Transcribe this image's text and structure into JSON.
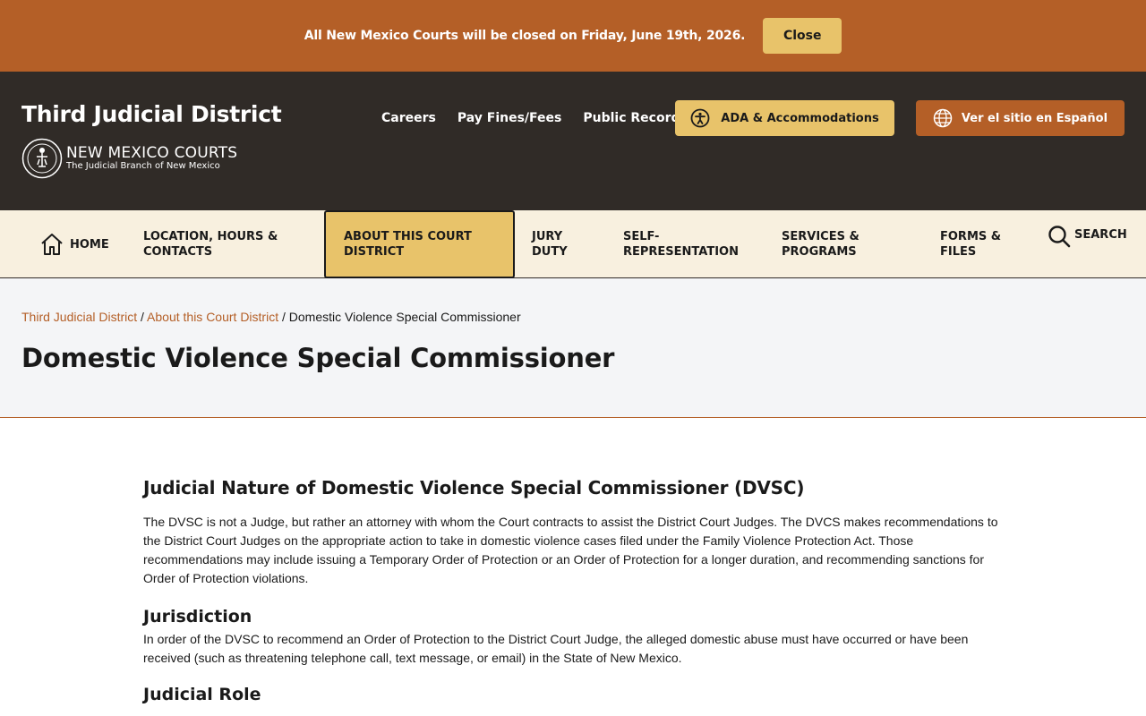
{
  "alert": {
    "text": "All New Mexico Courts will be closed on Friday, June 19th, 2026.",
    "close_label": "Close"
  },
  "header": {
    "site_title": "Third Judicial District",
    "logo_main": "NEW MEXICO COURTS",
    "logo_sub": "The Judicial Branch of New Mexico",
    "util_links": [
      "Careers",
      "Pay Fines/Fees",
      "Public Records"
    ],
    "ada_label": "ADA & Accommodations",
    "espanol_label": "Ver el sitio en Español"
  },
  "nav": {
    "home": "HOME",
    "location_line1": "LOCATION, HOURS &",
    "location_line2": "CONTACTS",
    "about_line1": "ABOUT THIS COURT",
    "about_line2": "DISTRICT",
    "jury_line1": "JURY",
    "jury_line2": "DUTY",
    "self_line1": "SELF-",
    "self_line2": "REPRESENTATION",
    "services_line1": "SERVICES &",
    "services_line2": "PROGRAMS",
    "forms_line1": "FORMS &",
    "forms_line2": "FILES",
    "search": "SEARCH"
  },
  "breadcrumb": {
    "crumb1": "Third Judicial District",
    "crumb2": "About this Court District",
    "current": "Domestic Violence Special Commissioner",
    "separator": "/"
  },
  "page": {
    "title": "Domestic Violence Special Commissioner"
  },
  "content": {
    "section1_heading": "Judicial Nature of Domestic Violence Special Commissioner (DVSC)",
    "section1_text": "The DVSC is not a Judge, but rather an attorney with whom the Court contracts to assist the District Court Judges. The DVCS makes recommendations to the District Court Judges on the appropriate action to take in domestic violence cases filed under the Family Violence Protection Act. Those recommendations may include issuing a Temporary Order of Protection or an Order of Protection for a longer duration, and recommending sanctions for Order of Protection violations.",
    "section2_heading": "Jurisdiction",
    "section2_text": "In order of the DVSC to recommend an Order of Protection to the District Court Judge, the alleged domestic abuse must have occurred or have been received (such as threatening telephone call, text message, or email) in the State of New Mexico.",
    "section3_heading": "Judicial Role"
  },
  "colors": {
    "accent": "#b45f27",
    "header_bg": "#302b27",
    "gold": "#e8c36a",
    "nav_bg": "#f8f0df"
  }
}
